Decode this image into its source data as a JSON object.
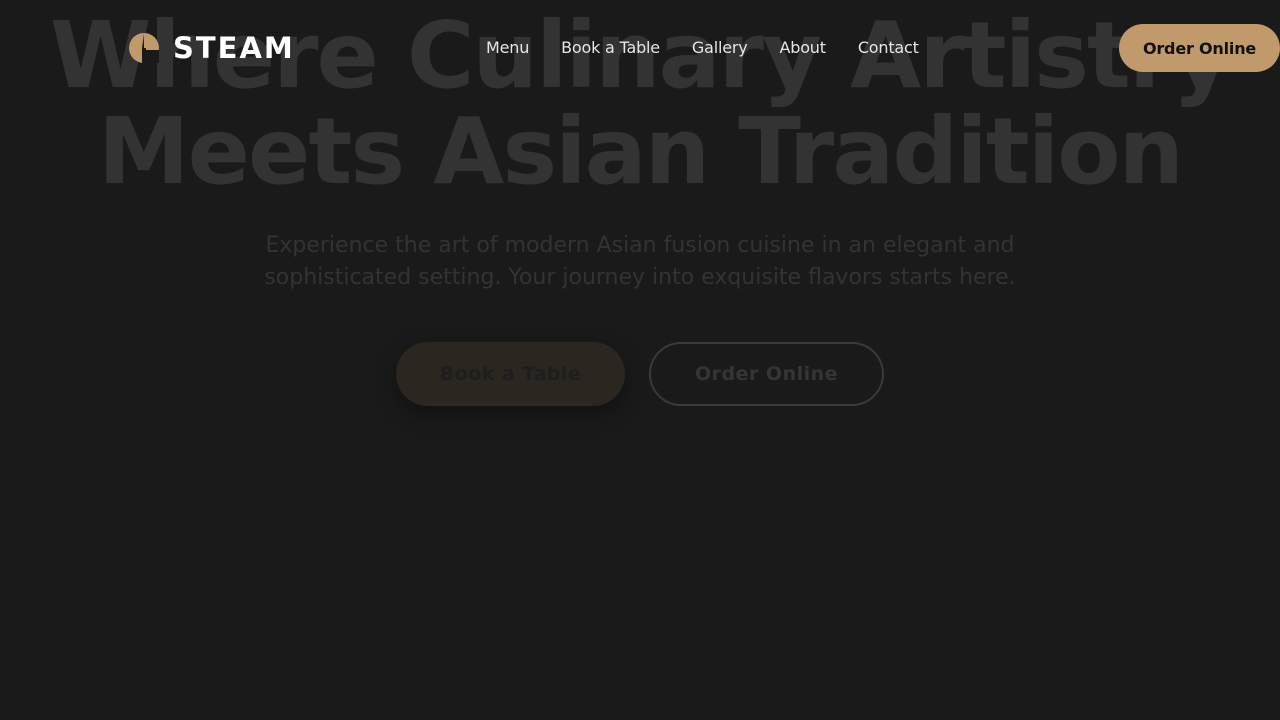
{
  "brand": {
    "name": "STEAM",
    "logo_icon": "steam-logo-icon",
    "accent_color": "#c09a6b"
  },
  "nav": {
    "items": [
      {
        "label": "Menu"
      },
      {
        "label": "Book a Table"
      },
      {
        "label": "Gallery"
      },
      {
        "label": "About"
      },
      {
        "label": "Contact"
      }
    ],
    "cta_label": "Order Online"
  },
  "hero": {
    "title_line1": "Where Culinary Artistry",
    "title_line2": "Meets Asian Tradition",
    "subtitle": "Experience the art of modern Asian fusion cuisine in an elegant and sophisticated setting. Your journey into exquisite flavors starts here.",
    "primary_label": "Book a Table",
    "secondary_label": "Order Online"
  },
  "colors": {
    "background": "#1a1a1a",
    "hero_text_dim": "#333333"
  }
}
